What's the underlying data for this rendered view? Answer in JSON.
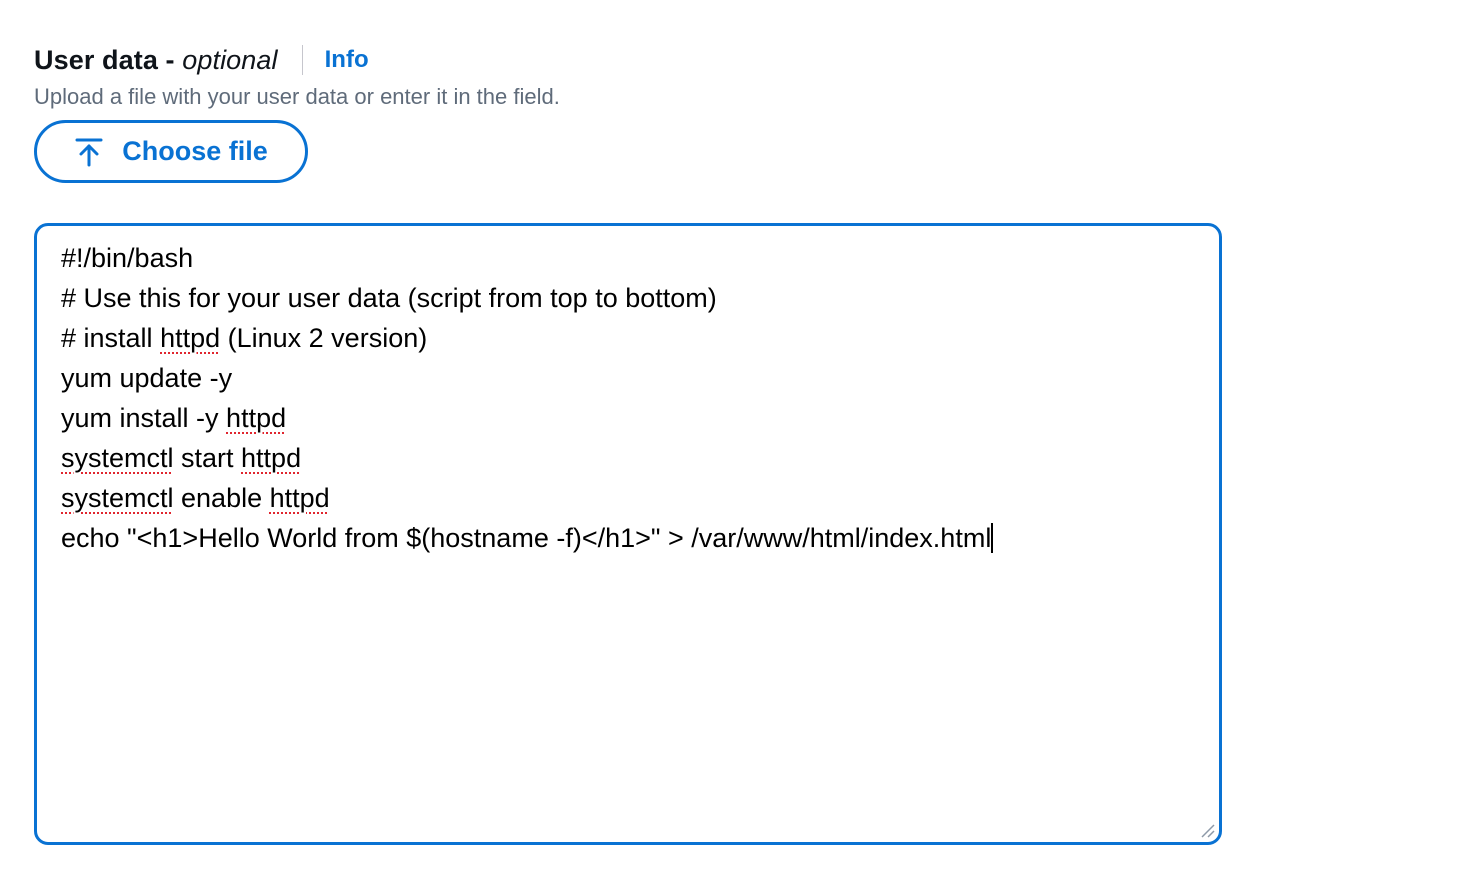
{
  "field": {
    "label_main": "User data - ",
    "label_optional": "optional",
    "info_link": "Info",
    "description": "Upload a file with your user data or enter it in the field."
  },
  "choose_file": {
    "label": "Choose file",
    "icon": "upload-icon"
  },
  "editor": {
    "lines": {
      "l0": "#!/bin/bash",
      "l1": "# Use this for your user data (script from top to bottom)",
      "l2a": "# install ",
      "l2b": "httpd",
      "l2c": " (Linux 2 version)",
      "l3": "yum update -y",
      "l4a": "yum install -y ",
      "l4b": "httpd",
      "l5a": "systemctl",
      "l5b": " start ",
      "l5c": "httpd",
      "l6a": "systemctl",
      "l6b": " enable ",
      "l6c": "httpd",
      "l7": "echo \"<h1>Hello World from $(hostname -f)</h1>\" > /var/www/html/index.html"
    }
  },
  "colors": {
    "accent": "#0972d3",
    "text": "#0f141a",
    "muted": "#5f6b7a",
    "spellcheck": "#e0252e"
  }
}
